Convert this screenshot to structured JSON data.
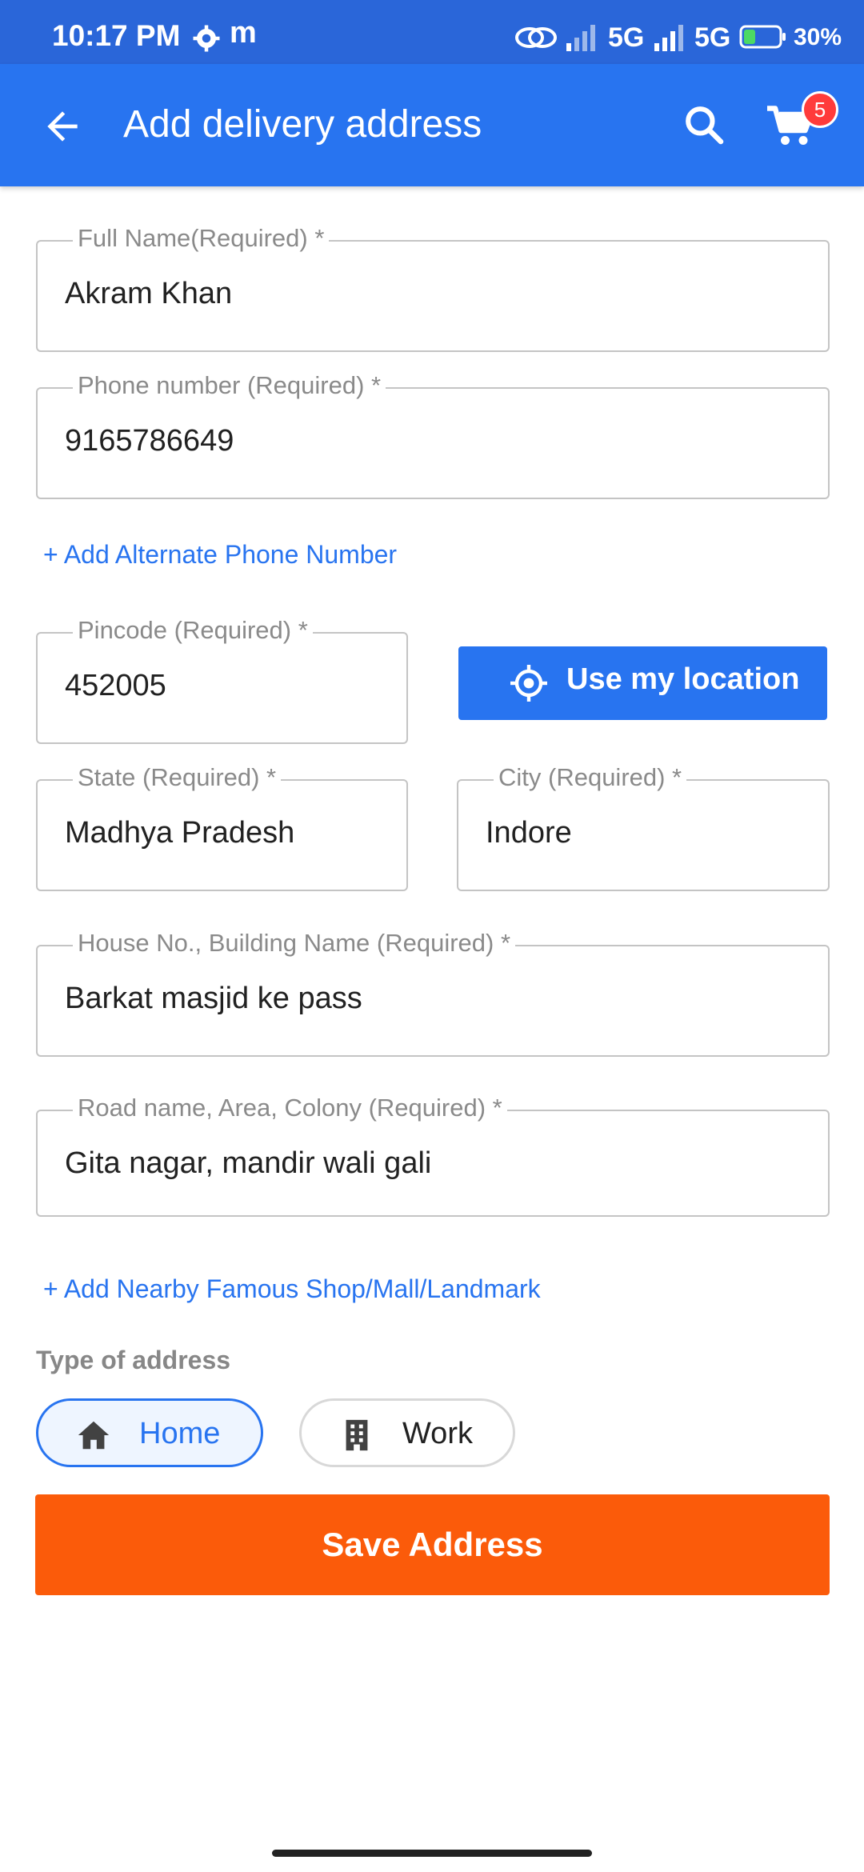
{
  "status_bar": {
    "time": "10:17 PM",
    "carrier_icon_letter": "m",
    "network1": "5G",
    "network2": "5G",
    "battery": "30%"
  },
  "app_bar": {
    "title": "Add delivery address",
    "cart_count": "5",
    "icons": [
      "back-arrow-icon",
      "search-icon",
      "cart-icon"
    ]
  },
  "form": {
    "full_name": {
      "label": "Full Name(Required) *",
      "value": "Akram Khan"
    },
    "phone": {
      "label": "Phone number (Required) *",
      "value": "9165786649"
    },
    "add_alt_phone": "+ Add Alternate Phone Number",
    "pincode": {
      "label": "Pincode (Required) *",
      "value": "452005"
    },
    "use_location": "Use my location",
    "state": {
      "label": "State (Required) *",
      "value": "Madhya Pradesh"
    },
    "city": {
      "label": "City (Required) *",
      "value": "Indore"
    },
    "house": {
      "label": "House No., Building Name (Required) *",
      "value": "Barkat masjid ke pass"
    },
    "road": {
      "label": "Road name, Area, Colony (Required) *",
      "value": "Gita nagar, mandir wali gali"
    },
    "add_landmark": "+ Add Nearby Famous Shop/Mall/Landmark",
    "address_type_label": "Type of address",
    "address_types": [
      {
        "label": "Home",
        "icon": "home-icon",
        "selected": true
      },
      {
        "label": "Work",
        "icon": "building-icon",
        "selected": false
      }
    ],
    "save_label": "Save Address"
  },
  "colors": {
    "primary": "#2874f0",
    "status_bar": "#2a66d9",
    "save_button": "#fb5b0a",
    "badge": "#ff3b3b"
  }
}
